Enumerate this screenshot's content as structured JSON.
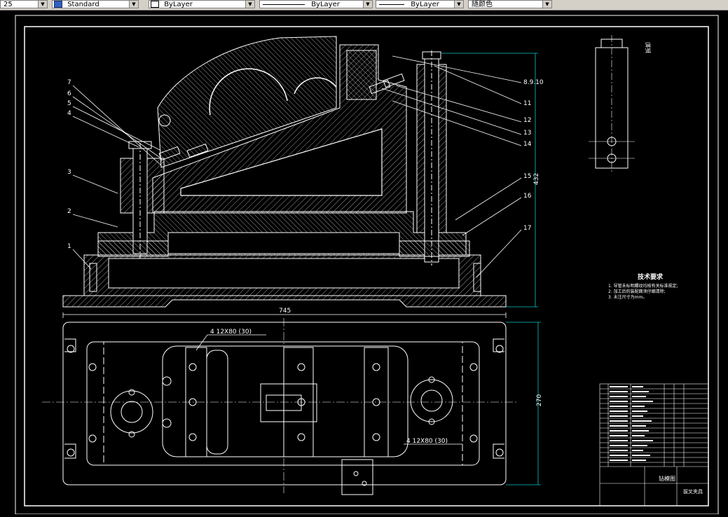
{
  "toolbar": {
    "layer_partial": "25",
    "textstyle": "Standard",
    "color": "ByLayer",
    "linetype": "ByLayer",
    "lineweight": "ByLayer",
    "plotstyle": "随颜色",
    "arrow": "▼"
  },
  "drawing": {
    "balloons": [
      "1",
      "2",
      "3",
      "4",
      "5",
      "6",
      "7",
      "8.9.10",
      "11",
      "12",
      "13",
      "14",
      "15",
      "16",
      "17"
    ],
    "dim_height": "432",
    "dim_width": "745",
    "dim_depth": "270",
    "slot_callout_top": "4  12X80 (30)",
    "slot_callout_bottom": "4  12X80 (30)",
    "side_label": "拆卸",
    "tech_title": "技术要求",
    "tech_notes": [
      "1. 导管未标明螺纹均按有关标准规定;",
      "2. 加工后的装配面须仔细清除;",
      "3. 未注尺寸为mm。"
    ],
    "title_block": {
      "drawing_name": "钻模图",
      "company": "拔叉夹具"
    }
  },
  "colors": {
    "background": "#000000",
    "lines": "#ffffff",
    "dimension": "#00c8c8",
    "toolbar": "#d4d0c8"
  }
}
